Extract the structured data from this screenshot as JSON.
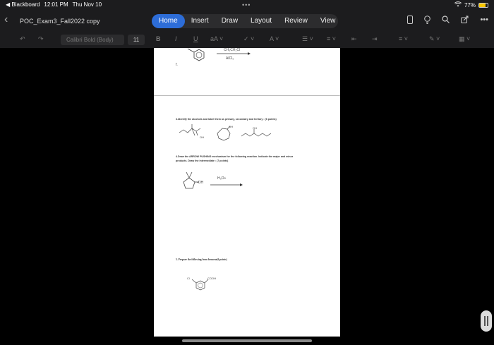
{
  "status": {
    "back_app": "◀ Blackboard",
    "time": "12:01 PM",
    "date": "Thu Nov 10",
    "battery": "77%",
    "battery_level": 0.77
  },
  "title_bar": {
    "doc_title": "POC_Exam3_Fall2022 copy",
    "tabs": [
      "Home",
      "Insert",
      "Draw",
      "Layout",
      "Review",
      "View"
    ],
    "active_tab": "Home"
  },
  "toolbar": {
    "font_name": "Calibri Bold (Body)",
    "font_size": "11",
    "bold": "B",
    "italic": "I",
    "underline": "U"
  },
  "document": {
    "top_reagent_1": "CH₃CH₂Cl",
    "top_reagent_2": "AlCl₃",
    "top_label": "f.",
    "q3": "3.Identify the alcohols and label them as primary, secondary and tertiary : (6 points)",
    "oh_label": "OH",
    "q4_line1": "4.Draw the ARROW PUSHING mechanism for the following reaction.  Indicate the major and minor",
    "q4_line2": "products. Draw the intermediate : (7 points)",
    "q4_reagent": "H₃O+",
    "q4_oh": "-OH",
    "q5": "5. Prepare the following from benzene(6 points)",
    "q5_cl": "Cl",
    "q5_cooh": "COOH"
  }
}
